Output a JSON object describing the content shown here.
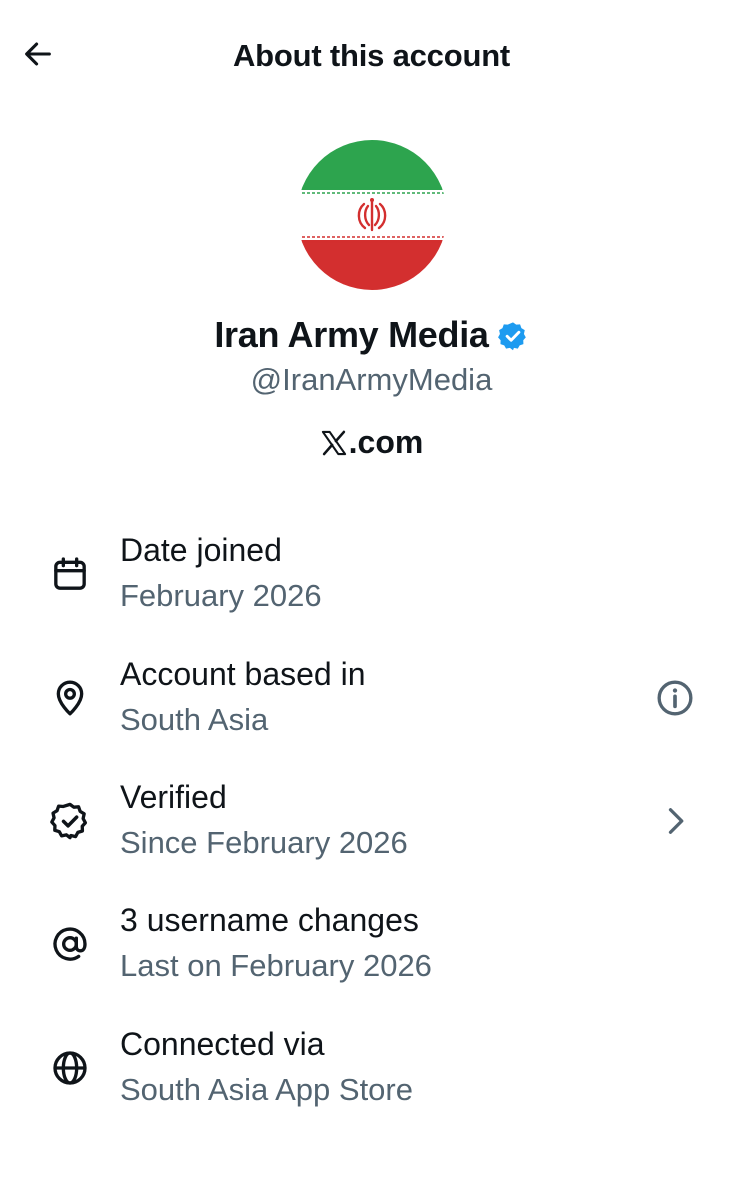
{
  "header": {
    "title": "About this account",
    "back_icon": "arrow-left-icon"
  },
  "profile": {
    "name": "Iran Army Media",
    "handle": "@IranArmyMedia",
    "site": ".com",
    "site_logo_icon": "x-logo-icon",
    "verified_badge_icon": "verified-badge-icon",
    "avatar": "iran-flag-avatar"
  },
  "rows": [
    {
      "icon": "calendar-icon",
      "title": "Date joined",
      "subtitle": "February 2026"
    },
    {
      "icon": "location-pin-icon",
      "title": "Account based in",
      "subtitle": "South Asia",
      "action_icon": "info-icon"
    },
    {
      "icon": "verified-check-icon",
      "title": "Verified",
      "subtitle": "Since February 2026",
      "action_icon": "chevron-right-icon"
    },
    {
      "icon": "at-sign-icon",
      "title": "3 username changes",
      "subtitle": "Last on February 2026"
    },
    {
      "icon": "globe-icon",
      "title": "Connected via",
      "subtitle": "South Asia App Store"
    }
  ],
  "colors": {
    "text_primary": "#0f1419",
    "text_secondary": "#536471",
    "verified_blue": "#1d9bf0",
    "flag_green": "#2da44e",
    "flag_red": "#d32f2f"
  }
}
